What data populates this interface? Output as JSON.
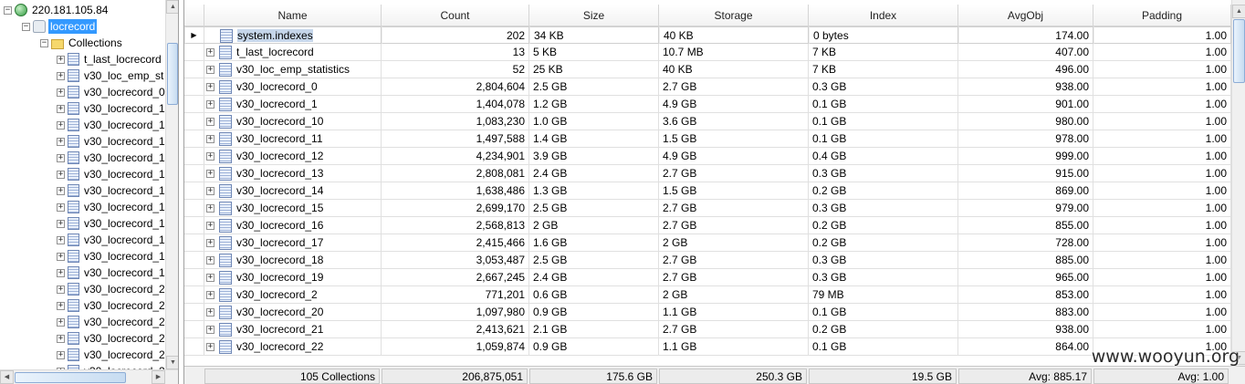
{
  "tree": {
    "server": "220.181.105.84",
    "database": "locrecord",
    "collections_folder": "Collections",
    "items": [
      "t_last_locrecord",
      "v30_loc_emp_st",
      "v30_locrecord_0",
      "v30_locrecord_1",
      "v30_locrecord_1",
      "v30_locrecord_1",
      "v30_locrecord_1",
      "v30_locrecord_1",
      "v30_locrecord_1",
      "v30_locrecord_1",
      "v30_locrecord_1",
      "v30_locrecord_1",
      "v30_locrecord_1",
      "v30_locrecord_1",
      "v30_locrecord_2",
      "v30_locrecord_2",
      "v30_locrecord_2",
      "v30_locrecord_2",
      "v30_locrecord_2",
      "v30_locrecord_2"
    ],
    "expander_symbol": "+",
    "collapse_symbol": "−"
  },
  "grid": {
    "columns": [
      "Name",
      "Count",
      "Size",
      "Storage",
      "Index",
      "AvgObj",
      "Padding"
    ],
    "current_row_indicator": "▶",
    "rows": [
      {
        "name": "system.indexes",
        "count": "202",
        "size": "34 KB",
        "storage": "40 KB",
        "index": "0 bytes",
        "avgobj": "174.00",
        "padding": "1.00",
        "expandable": false
      },
      {
        "name": "t_last_locrecord",
        "count": "13",
        "size": "5 KB",
        "storage": "10.7 MB",
        "index": "7 KB",
        "avgobj": "407.00",
        "padding": "1.00",
        "expandable": true
      },
      {
        "name": "v30_loc_emp_statistics",
        "count": "52",
        "size": "25 KB",
        "storage": "40 KB",
        "index": "7 KB",
        "avgobj": "496.00",
        "padding": "1.00",
        "expandable": true
      },
      {
        "name": "v30_locrecord_0",
        "count": "2,804,604",
        "size": "2.5 GB",
        "storage": "2.7 GB",
        "index": "0.3 GB",
        "avgobj": "938.00",
        "padding": "1.00",
        "expandable": true
      },
      {
        "name": "v30_locrecord_1",
        "count": "1,404,078",
        "size": "1.2 GB",
        "storage": "4.9 GB",
        "index": "0.1 GB",
        "avgobj": "901.00",
        "padding": "1.00",
        "expandable": true
      },
      {
        "name": "v30_locrecord_10",
        "count": "1,083,230",
        "size": "1.0 GB",
        "storage": "3.6 GB",
        "index": "0.1 GB",
        "avgobj": "980.00",
        "padding": "1.00",
        "expandable": true
      },
      {
        "name": "v30_locrecord_11",
        "count": "1,497,588",
        "size": "1.4 GB",
        "storage": "1.5 GB",
        "index": "0.1 GB",
        "avgobj": "978.00",
        "padding": "1.00",
        "expandable": true
      },
      {
        "name": "v30_locrecord_12",
        "count": "4,234,901",
        "size": "3.9 GB",
        "storage": "4.9 GB",
        "index": "0.4 GB",
        "avgobj": "999.00",
        "padding": "1.00",
        "expandable": true
      },
      {
        "name": "v30_locrecord_13",
        "count": "2,808,081",
        "size": "2.4 GB",
        "storage": "2.7 GB",
        "index": "0.3 GB",
        "avgobj": "915.00",
        "padding": "1.00",
        "expandable": true
      },
      {
        "name": "v30_locrecord_14",
        "count": "1,638,486",
        "size": "1.3 GB",
        "storage": "1.5 GB",
        "index": "0.2 GB",
        "avgobj": "869.00",
        "padding": "1.00",
        "expandable": true
      },
      {
        "name": "v30_locrecord_15",
        "count": "2,699,170",
        "size": "2.5 GB",
        "storage": "2.7 GB",
        "index": "0.3 GB",
        "avgobj": "979.00",
        "padding": "1.00",
        "expandable": true
      },
      {
        "name": "v30_locrecord_16",
        "count": "2,568,813",
        "size": "2 GB",
        "storage": "2.7 GB",
        "index": "0.2 GB",
        "avgobj": "855.00",
        "padding": "1.00",
        "expandable": true
      },
      {
        "name": "v30_locrecord_17",
        "count": "2,415,466",
        "size": "1.6 GB",
        "storage": "2 GB",
        "index": "0.2 GB",
        "avgobj": "728.00",
        "padding": "1.00",
        "expandable": true
      },
      {
        "name": "v30_locrecord_18",
        "count": "3,053,487",
        "size": "2.5 GB",
        "storage": "2.7 GB",
        "index": "0.3 GB",
        "avgobj": "885.00",
        "padding": "1.00",
        "expandable": true
      },
      {
        "name": "v30_locrecord_19",
        "count": "2,667,245",
        "size": "2.4 GB",
        "storage": "2.7 GB",
        "index": "0.3 GB",
        "avgobj": "965.00",
        "padding": "1.00",
        "expandable": true
      },
      {
        "name": "v30_locrecord_2",
        "count": "771,201",
        "size": "0.6 GB",
        "storage": "2 GB",
        "index": "79 MB",
        "avgobj": "853.00",
        "padding": "1.00",
        "expandable": true
      },
      {
        "name": "v30_locrecord_20",
        "count": "1,097,980",
        "size": "0.9 GB",
        "storage": "1.1 GB",
        "index": "0.1 GB",
        "avgobj": "883.00",
        "padding": "1.00",
        "expandable": true
      },
      {
        "name": "v30_locrecord_21",
        "count": "2,413,621",
        "size": "2.1 GB",
        "storage": "2.7 GB",
        "index": "0.2 GB",
        "avgobj": "938.00",
        "padding": "1.00",
        "expandable": true
      },
      {
        "name": "v30_locrecord_22",
        "count": "1,059,874",
        "size": "0.9 GB",
        "storage": "1.1 GB",
        "index": "0.1 GB",
        "avgobj": "864.00",
        "padding": "1.00",
        "expandable": true
      }
    ],
    "footer": {
      "name": "105 Collections",
      "count": "206,875,051",
      "size": "175.6 GB",
      "storage": "250.3 GB",
      "index": "19.5 GB",
      "avgobj": "Avg: 885.17",
      "padding": "Avg: 1.00"
    }
  },
  "watermark": "www.wooyun.org",
  "colors": {
    "selection": "#3399ff",
    "selected_row": "#c6d6ea",
    "header_bg": "#f2f2f2"
  }
}
